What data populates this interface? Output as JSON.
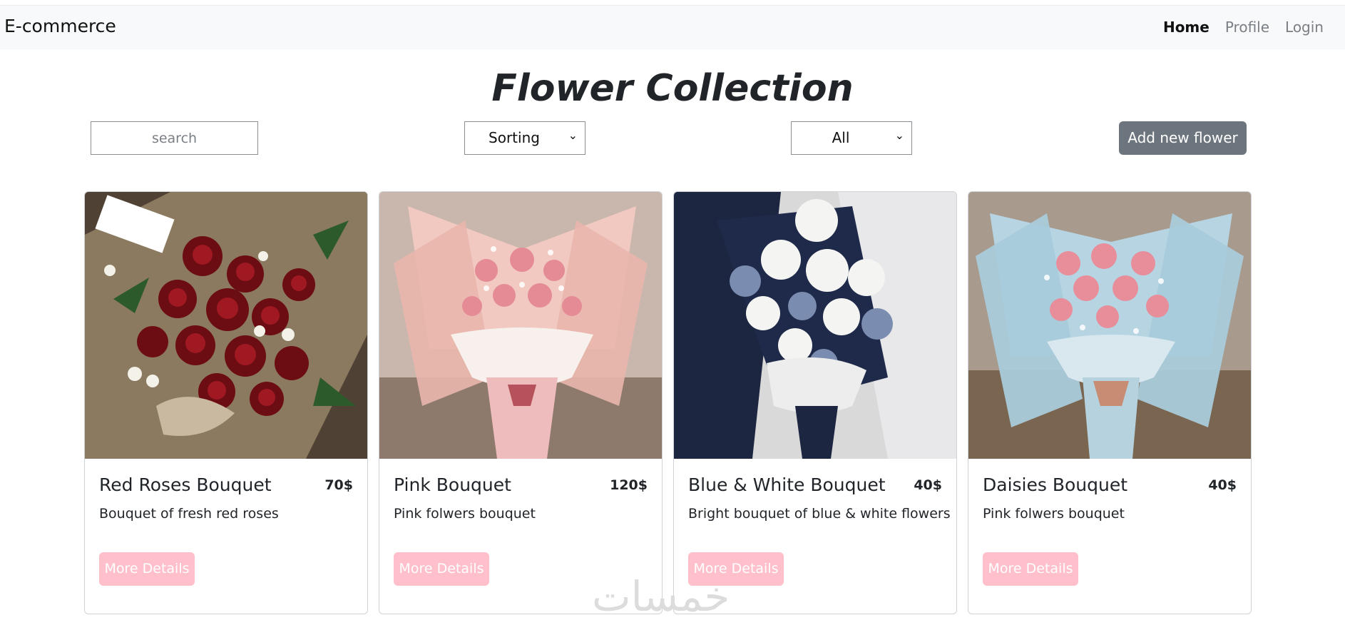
{
  "navbar": {
    "brand": "E-commerce",
    "links": [
      "Home",
      "Profile",
      "Login"
    ]
  },
  "title": "Flower Collection",
  "controls": {
    "search_placeholder": "search",
    "sorting": "Sorting",
    "filter": "All",
    "add_button": "Add new flower"
  },
  "cards": [
    {
      "title": "Red Roses Bouquet",
      "price": "70$",
      "desc": "Bouquet of fresh red roses",
      "button": "More Details"
    },
    {
      "title": "Pink Bouquet",
      "price": "120$",
      "desc": "Pink folwers bouquet",
      "button": "More Details"
    },
    {
      "title": "Blue & White Bouquet",
      "price": "40$",
      "desc": "Bright bouquet of blue & white flowers",
      "button": "More Details"
    },
    {
      "title": "Daisies Bouquet",
      "price": "40$",
      "desc": "Pink folwers bouquet",
      "button": "More Details"
    }
  ],
  "watermark": "خمسات",
  "colors": {
    "navbar_bg": "#f8f9fa",
    "add_button_bg": "#6c757d",
    "details_button_bg": "#ffc0cb"
  }
}
